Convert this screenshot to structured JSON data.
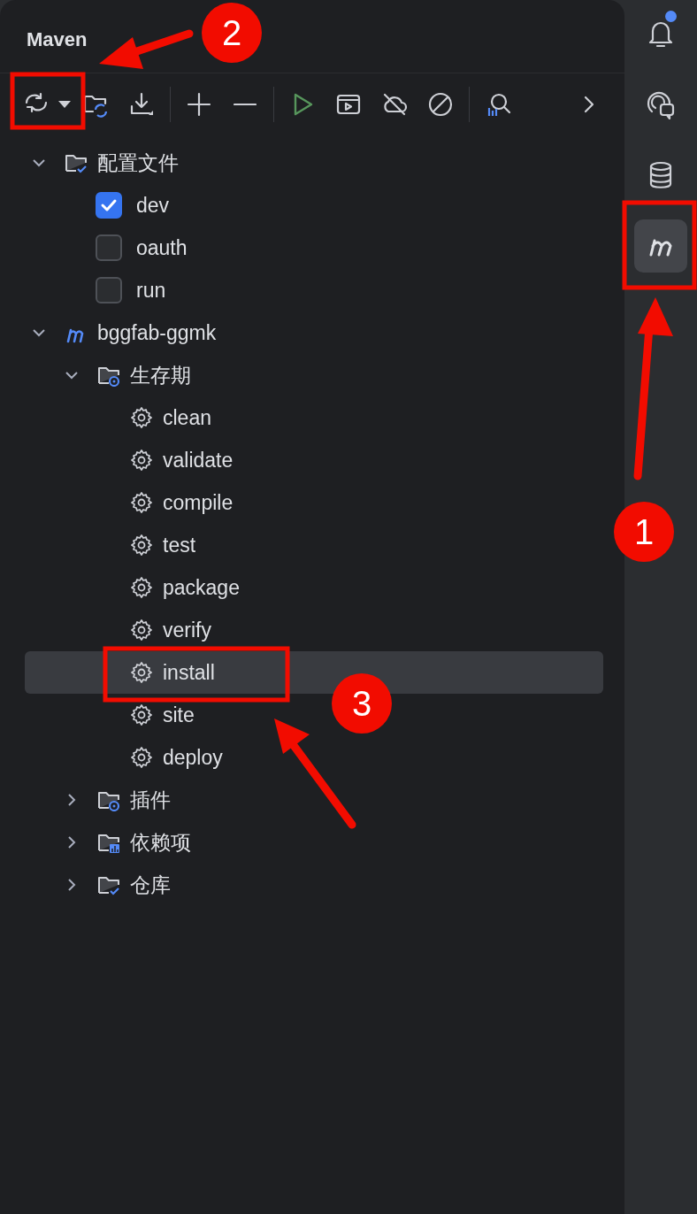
{
  "panel": {
    "title": "Maven"
  },
  "toolbar": [
    {
      "kind": "sync"
    },
    {
      "kind": "caret"
    },
    {
      "kind": "reimport"
    },
    {
      "kind": "download"
    },
    {
      "kind": "separator"
    },
    {
      "kind": "add"
    },
    {
      "kind": "remove"
    },
    {
      "kind": "separator"
    },
    {
      "kind": "run"
    },
    {
      "kind": "runconfig"
    },
    {
      "kind": "offline"
    },
    {
      "kind": "skiptests"
    },
    {
      "kind": "separator"
    },
    {
      "kind": "analyze"
    },
    {
      "kind": "more"
    }
  ],
  "tree": [
    {
      "label": "配置文件",
      "kind": "profiles",
      "expanded": true,
      "selected": false,
      "children": [
        {
          "label": "dev",
          "kind": "profile",
          "checked": true,
          "selected": false
        },
        {
          "label": "oauth",
          "kind": "profile",
          "checked": false,
          "selected": false
        },
        {
          "label": "run",
          "kind": "profile",
          "checked": false,
          "selected": false
        }
      ]
    },
    {
      "label": "bggfab-ggmk",
      "kind": "project",
      "expanded": true,
      "selected": false,
      "children": [
        {
          "label": "生存期",
          "kind": "lifecycle",
          "expanded": true,
          "selected": false,
          "children": [
            {
              "label": "clean",
              "kind": "goal",
              "selected": false
            },
            {
              "label": "validate",
              "kind": "goal",
              "selected": false
            },
            {
              "label": "compile",
              "kind": "goal",
              "selected": false
            },
            {
              "label": "test",
              "kind": "goal",
              "selected": false
            },
            {
              "label": "package",
              "kind": "goal",
              "selected": false
            },
            {
              "label": "verify",
              "kind": "goal",
              "selected": false
            },
            {
              "label": "install",
              "kind": "goal",
              "selected": true
            },
            {
              "label": "site",
              "kind": "goal",
              "selected": false
            },
            {
              "label": "deploy",
              "kind": "goal",
              "selected": false
            }
          ]
        },
        {
          "label": "插件",
          "kind": "plugins",
          "expanded": false,
          "selected": false
        },
        {
          "label": "依赖项",
          "kind": "dependencies",
          "expanded": false,
          "selected": false
        },
        {
          "label": "仓库",
          "kind": "repositories",
          "expanded": false,
          "selected": false
        }
      ]
    }
  ],
  "side_bar": [
    {
      "kind": "notifications",
      "unread": true,
      "selected": false
    },
    {
      "kind": "assistant",
      "selected": false
    },
    {
      "kind": "database",
      "selected": false
    },
    {
      "kind": "maven",
      "selected": true
    }
  ],
  "callouts": [
    {
      "label": "1"
    },
    {
      "label": "2"
    },
    {
      "label": "3"
    }
  ]
}
